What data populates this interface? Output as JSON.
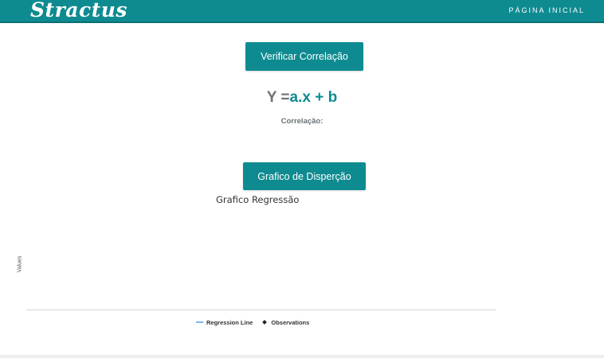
{
  "header": {
    "logo": "Stractus",
    "nav_home": "PÁGINA INICIAL"
  },
  "actions": {
    "verify_label": "Verificar Correlação",
    "scatter_label": "Grafico de Disperção"
  },
  "formula": {
    "y_part": "Y =",
    "rest": "a.x + b"
  },
  "correlation_label": "Correlação:",
  "chart": {
    "title": "Grafico Regressão",
    "ylabel": "Values",
    "legend": [
      "Regression Line",
      "Observations"
    ]
  },
  "colors": {
    "accent": "#0e8b90",
    "regression_line": "#7cb5ec",
    "observation_marker": "#222222"
  },
  "chart_data": {
    "type": "scatter",
    "title": "Grafico Regressão",
    "xlabel": "",
    "ylabel": "Values",
    "series": [
      {
        "name": "Regression Line",
        "values": []
      },
      {
        "name": "Observations",
        "values": []
      }
    ],
    "legend_position": "bottom-center",
    "grid": false
  }
}
